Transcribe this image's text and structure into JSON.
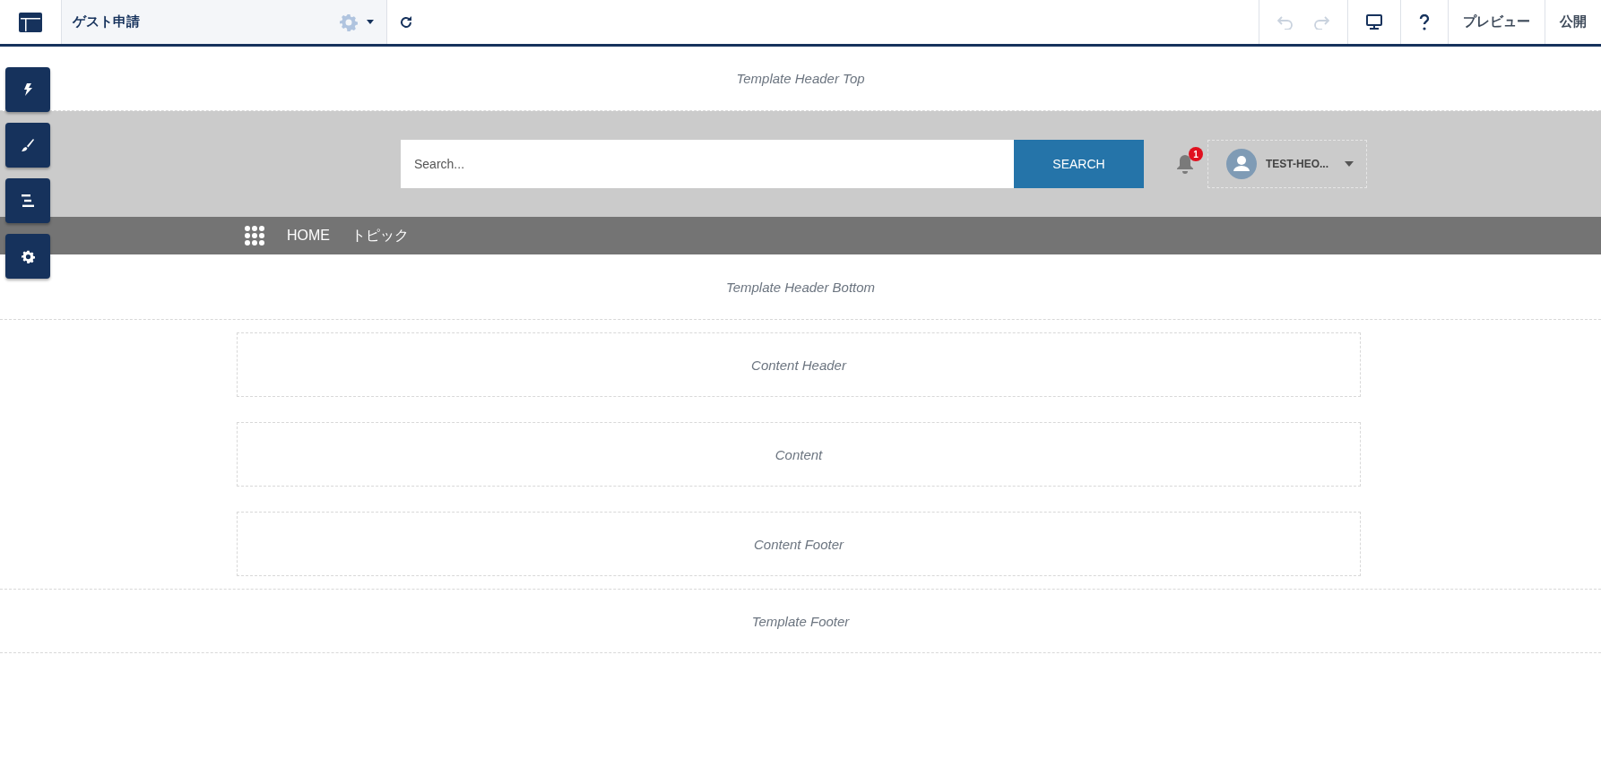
{
  "toolbar": {
    "page_name": "ゲスト申請",
    "undo_disabled": true,
    "redo_disabled": true,
    "preview": "プレビュー",
    "publish": "公開"
  },
  "side_tools": [
    {
      "kind": "lightning"
    },
    {
      "kind": "brush"
    },
    {
      "kind": "list"
    },
    {
      "kind": "gear"
    }
  ],
  "regions": {
    "header_top": "Template Header Top",
    "header_bottom": "Template Header Bottom",
    "content_header": "Content Header",
    "content": "Content",
    "content_footer": "Content Footer",
    "footer": "Template Footer"
  },
  "search": {
    "placeholder": "Search...",
    "button": "SEARCH"
  },
  "notifications": {
    "count": "1"
  },
  "user": {
    "name": "TEST-HEO..."
  },
  "nav": [
    {
      "label": "HOME"
    },
    {
      "label": "トピック"
    }
  ]
}
